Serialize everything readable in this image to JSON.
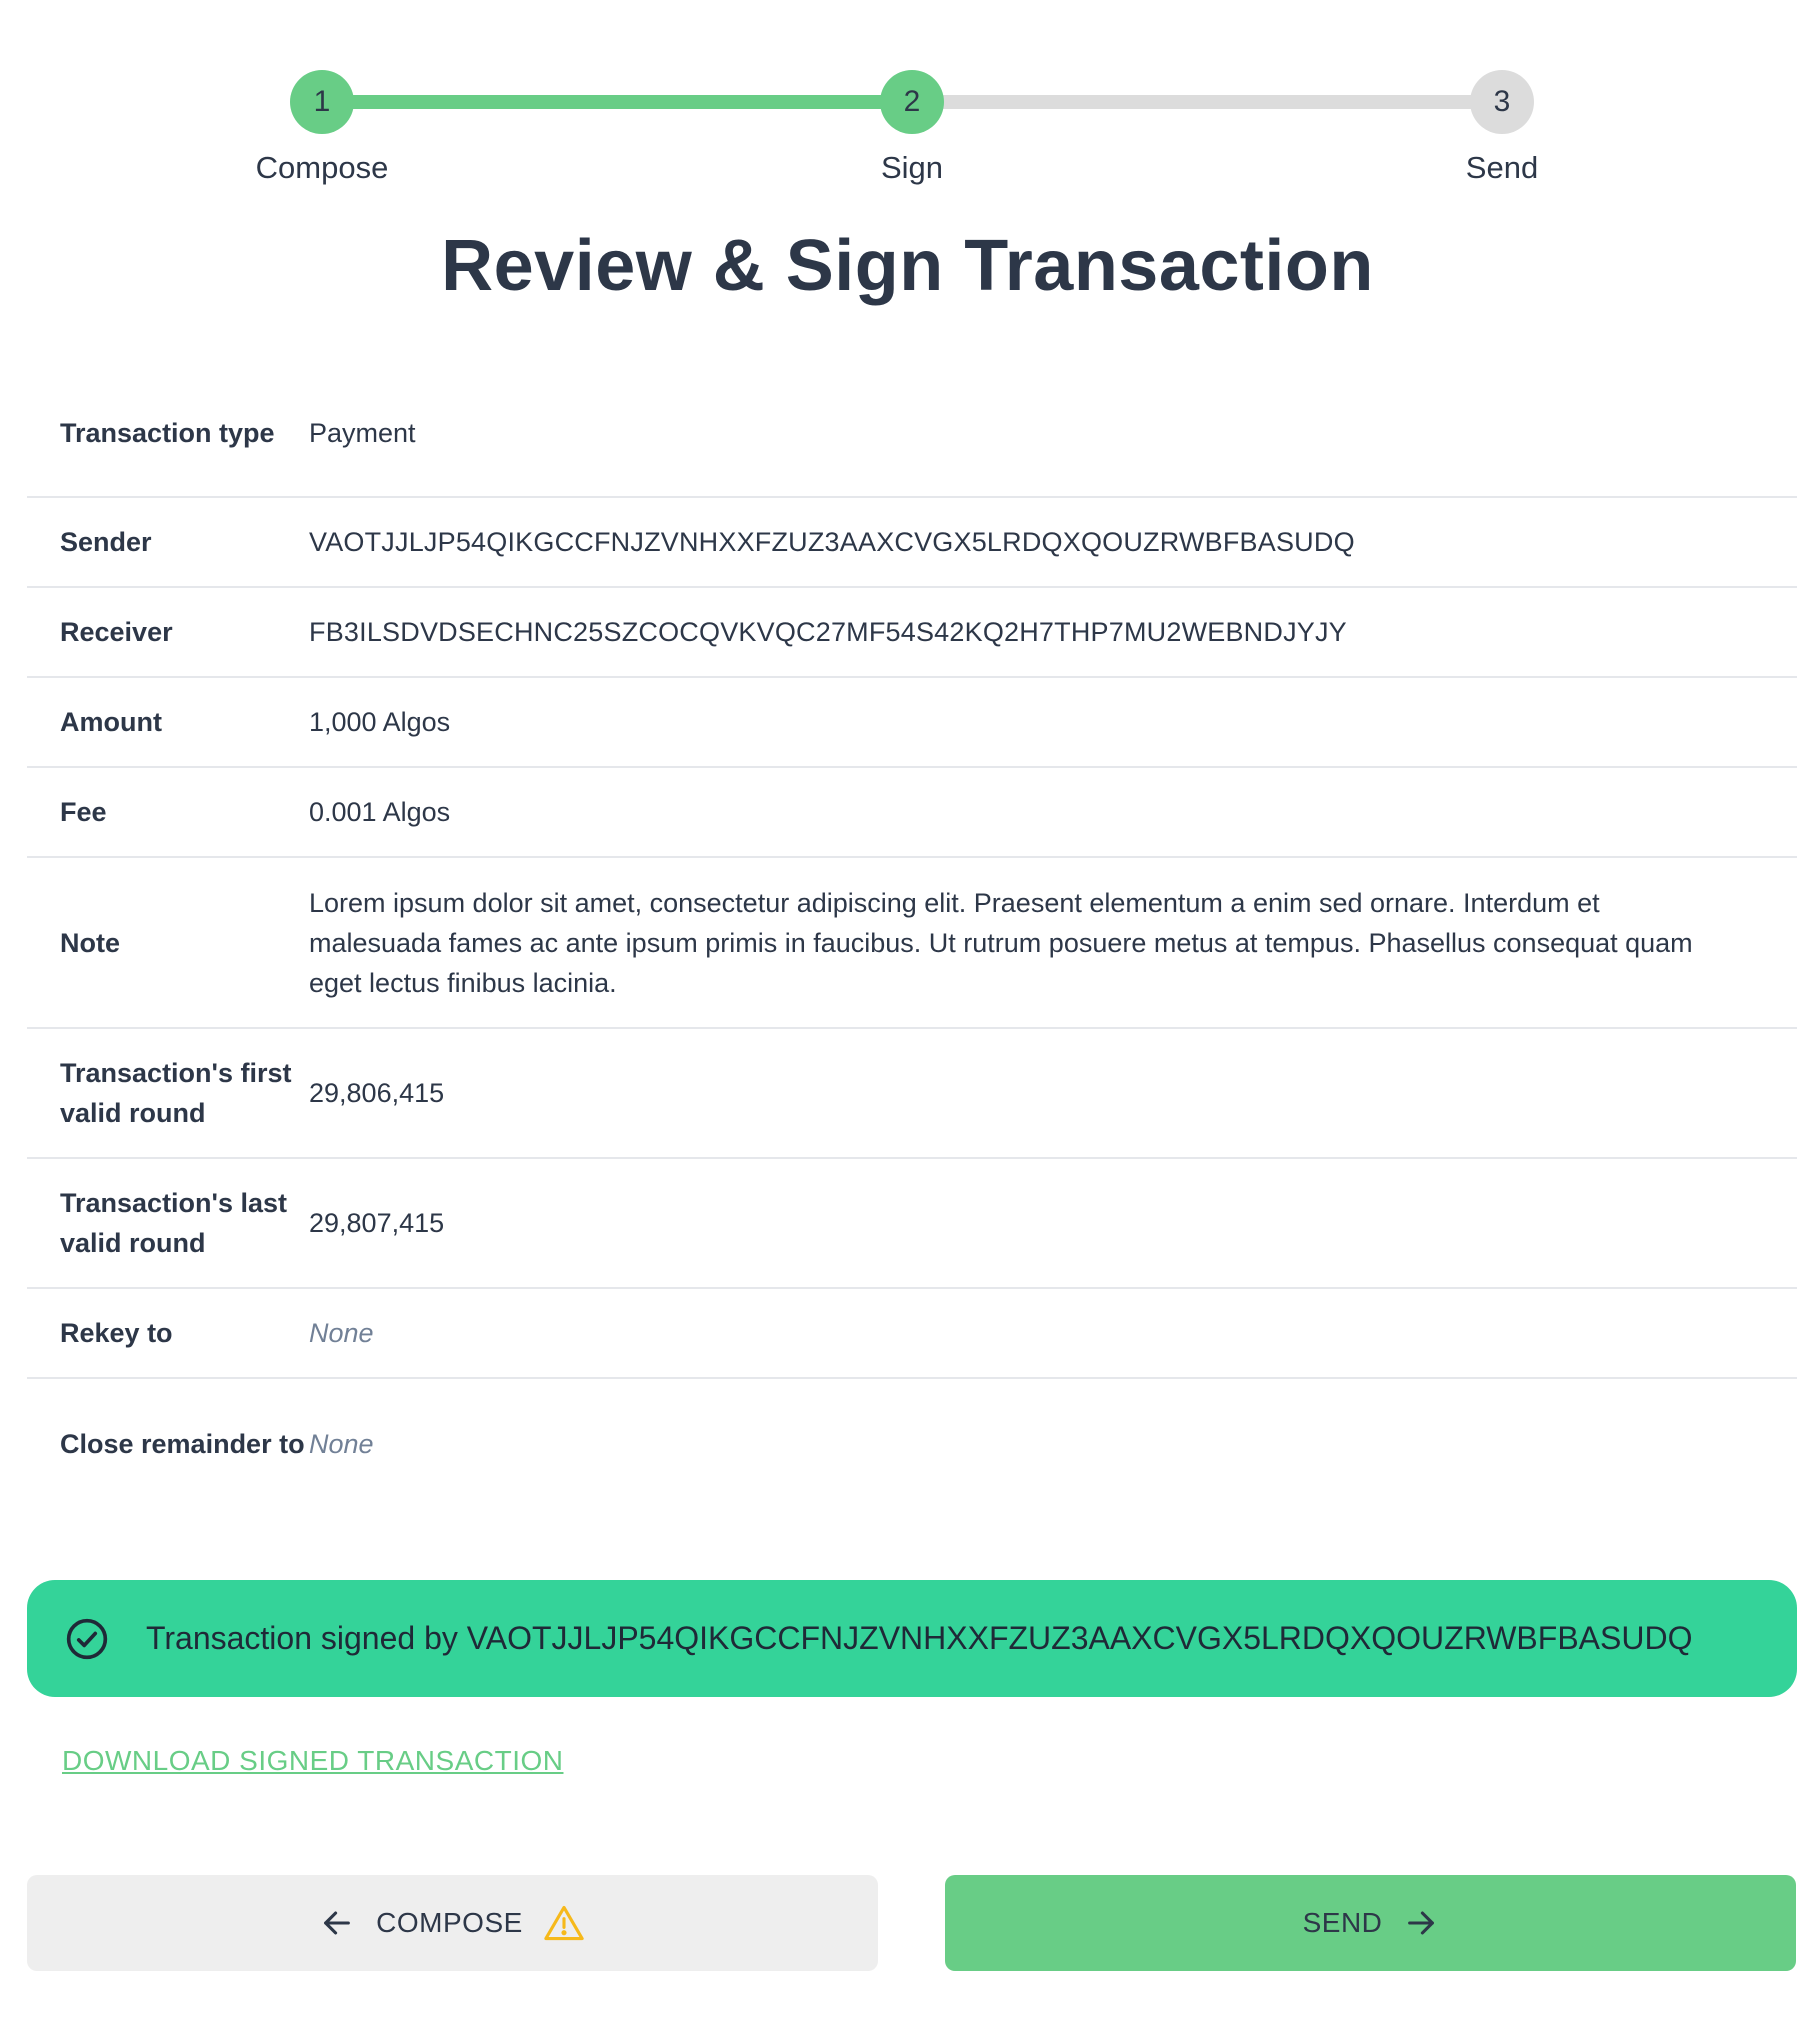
{
  "stepper": {
    "steps": [
      {
        "number": "1",
        "label": "Compose",
        "state": "done"
      },
      {
        "number": "2",
        "label": "Sign",
        "state": "done"
      },
      {
        "number": "3",
        "label": "Send",
        "state": "todo"
      }
    ]
  },
  "title": "Review & Sign Transaction",
  "details": [
    {
      "label": "Transaction type",
      "value": "Payment"
    },
    {
      "label": "Sender",
      "value": "VAOTJJLJP54QIKGCCFNJZVNHXXFZUZ3AAXCVGX5LRDQXQOUZRWBFBASUDQ"
    },
    {
      "label": "Receiver",
      "value": "FB3ILSDVDSECHNC25SZCOCQVKVQC27MF54S42KQ2H7THP7MU2WEBNDJYJY"
    },
    {
      "label": "Amount",
      "value": "1,000 Algos"
    },
    {
      "label": "Fee",
      "value": "0.001 Algos"
    },
    {
      "label": "Note",
      "value": "Lorem ipsum dolor sit amet, consectetur adipiscing elit. Praesent elementum a enim sed ornare. Interdum et malesuada fames ac ante ipsum primis in faucibus. Ut rutrum posuere metus at tempus. Phasellus consequat quam eget lectus finibus lacinia."
    },
    {
      "label": "Transaction's first valid round",
      "value": "29,806,415"
    },
    {
      "label": "Transaction's last valid round",
      "value": "29,807,415"
    },
    {
      "label": "Rekey to",
      "value": "None"
    },
    {
      "label": "Close remainder to",
      "value": "None"
    }
  ],
  "banner": {
    "icon": "check-circle-icon",
    "text": "Transaction signed by VAOTJJLJP54QIKGCCFNJZVNHXXFZUZ3AAXCVGX5LRDQXQOUZRWBFBASUDQ",
    "color": "#34d399"
  },
  "download_link": "DOWNLOAD SIGNED TRANSACTION",
  "buttons": {
    "compose": {
      "label": "COMPOSE",
      "icons": [
        "arrow-left-icon",
        "warning-icon"
      ]
    },
    "send": {
      "label": "SEND",
      "icons": [
        "arrow-right-icon"
      ]
    }
  },
  "colors": {
    "accent": "#68cd86",
    "success_banner": "#34d399",
    "warning": "#f6b91b",
    "text": "#2d3748"
  }
}
